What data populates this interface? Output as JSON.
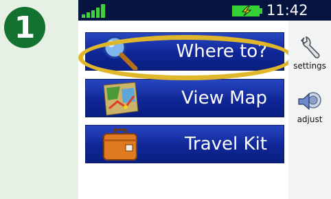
{
  "step_badge": "1",
  "status_bar": {
    "time": "11:42",
    "signal_icon": "signal-strength-icon",
    "battery_icon": "battery-charging-icon"
  },
  "main_menu": [
    {
      "label": "Where to?",
      "icon": "magnifier-icon"
    },
    {
      "label": "View Map",
      "icon": "map-icon"
    },
    {
      "label": "Travel Kit",
      "icon": "suitcase-icon"
    }
  ],
  "side_menu": [
    {
      "label": "settings",
      "icon": "wrench-icon"
    },
    {
      "label": "adjust",
      "icon": "speaker-icon"
    }
  ],
  "colors": {
    "button_blue": "#0f2696",
    "highlight": "#e0b72a",
    "badge_green": "#13722f",
    "status_bar": "#05153f"
  }
}
